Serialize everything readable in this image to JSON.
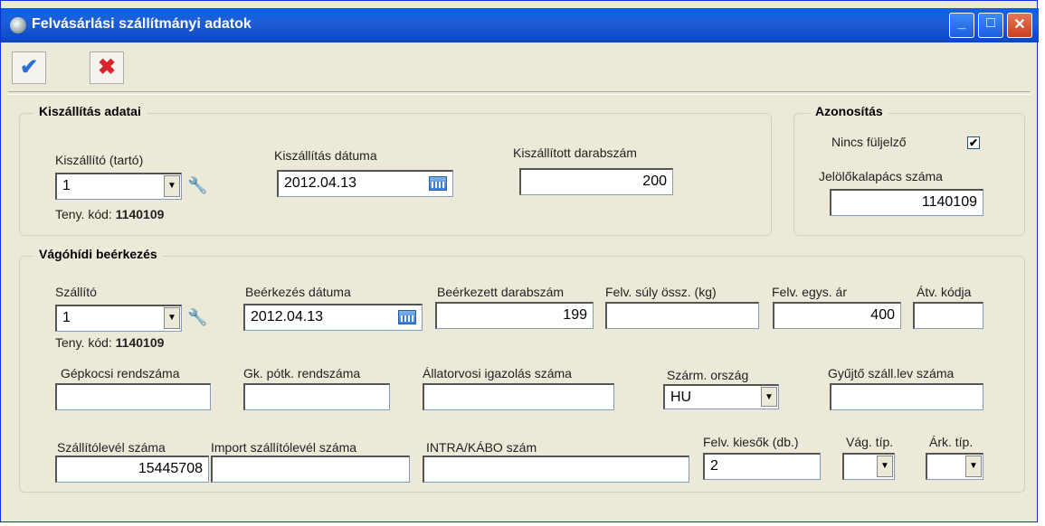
{
  "window": {
    "title": "Felvásárlási szállítmányi adatok"
  },
  "titlebar_buttons": {
    "minimize": "_",
    "maximize": "□",
    "close": "✕"
  },
  "toolbar": {
    "ok_icon": "checkmark-icon",
    "cancel_icon": "cross-icon",
    "ok_glyph": "✔",
    "cancel_glyph": "✖"
  },
  "kiszallitas": {
    "legend": "Kiszállítás adatai",
    "kiszallito_label": "Kiszállító (tartó)",
    "kiszallito_value": "1",
    "teny_kod_label": "Teny. kód:",
    "teny_kod_value": "1140109",
    "datum_label": "Kiszállítás dátuma",
    "datum_value": "2012.04.13",
    "darabszam_label": "Kiszállított darabszám",
    "darabszam_value": "200"
  },
  "azonositas": {
    "legend": "Azonosítás",
    "nincs_label": "Nincs füljelző",
    "nincs_checked": "✔",
    "jelolo_label": "Jelölőkalapács száma",
    "jelolo_value": "1140109"
  },
  "vagohidi": {
    "legend": "Vágóhídi beérkezés",
    "szallito_label": "Szállító",
    "szallito_value": "1",
    "teny_kod_label": "Teny. kód:",
    "teny_kod_value": "1140109",
    "beerkezes_datum_label": "Beérkezés dátuma",
    "beerkezes_datum_value": "2012.04.13",
    "beerkezett_darab_label": "Beérkezett darabszám",
    "beerkezett_darab_value": "199",
    "felv_suly_label": "Felv. súly össz. (kg)",
    "felv_suly_value": "",
    "felv_egys_ar_label": "Felv. egys. ár",
    "felv_egys_ar_value": "400",
    "atv_kod_label": "Átv. kódja",
    "atv_kod_value": "",
    "gepkocsi_label": "Gépkocsi rendszáma",
    "gepkocsi_value": "",
    "gk_potk_label": "Gk. pótk. rendszáma",
    "gk_potk_value": "",
    "allatorvosi_label": "Állatorvosi igazolás száma",
    "allatorvosi_value": "",
    "szarm_orszag_label": "Szárm. ország",
    "szarm_orszag_value": "HU",
    "gyujto_label": "Gyűjtő száll.lev száma",
    "gyujto_value": "",
    "szallitolevel_label": "Szállítólevél száma",
    "szallitolevel_value": "15445708",
    "import_label": "Import szállítólevél száma",
    "import_value": "",
    "intra_label": "INTRA/KÁBO szám",
    "intra_value": "",
    "kiesok_label": "Felv. kiesők (db.)",
    "kiesok_value": "2",
    "vag_tip_label": "Vág. típ.",
    "vag_tip_value": "",
    "ark_tip_label": "Árk. típ.",
    "ark_tip_value": ""
  }
}
